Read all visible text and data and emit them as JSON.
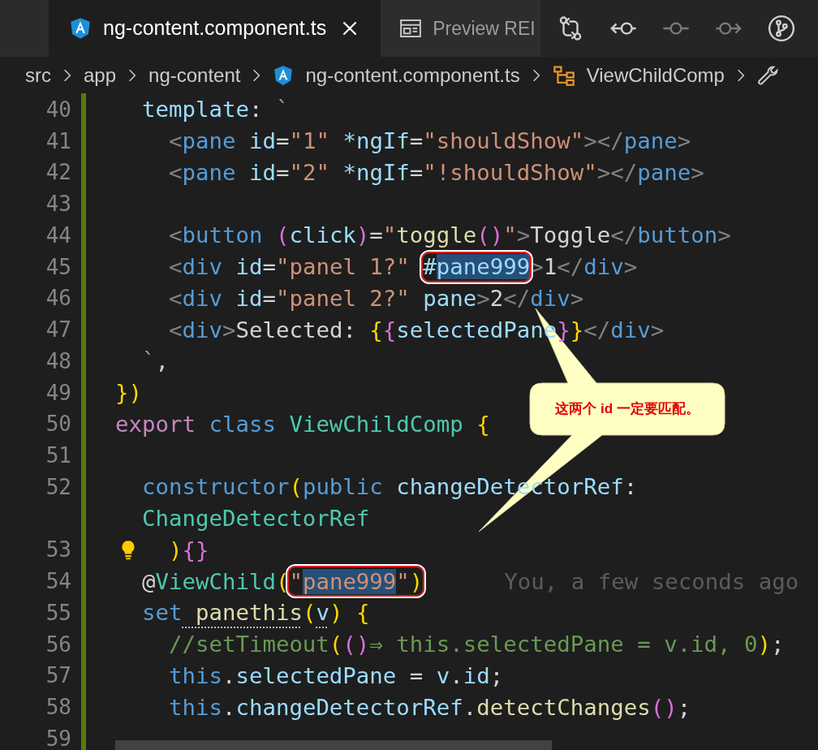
{
  "tabs": [
    {
      "kind": "angular",
      "label": "ng-content.component.ts",
      "selected": true
    },
    {
      "kind": "preview",
      "label": "Preview REI",
      "selected": false
    }
  ],
  "toolbar_buttons": [
    {
      "kind": "compare",
      "disabled": false
    },
    {
      "kind": "back",
      "disabled": false
    },
    {
      "kind": "dot",
      "disabled": true
    },
    {
      "kind": "forward",
      "disabled": true
    },
    {
      "kind": "branch",
      "disabled": false
    }
  ],
  "breadcrumb": [
    {
      "kind": "folder",
      "label": "src"
    },
    {
      "kind": "folder",
      "label": "app"
    },
    {
      "kind": "folder",
      "label": "ng-content"
    },
    {
      "kind": "angular",
      "label": "ng-content.component.ts"
    },
    {
      "kind": "class",
      "label": "ViewChildComp"
    },
    {
      "kind": "method"
    }
  ],
  "editor": {
    "lines": [
      {
        "number": "40",
        "tokens": [
          {
            "kind": "var",
            "text": "  template"
          },
          {
            "kind": "plain",
            "text": ":"
          },
          {
            "kind": "string",
            "text": " `"
          }
        ]
      },
      {
        "number": "41",
        "tokens": [
          {
            "kind": "tag",
            "text": "    <"
          },
          {
            "kind": "tagname",
            "text": "pane"
          },
          {
            "kind": "var",
            "text": " id"
          },
          {
            "kind": "plain",
            "text": "="
          },
          {
            "kind": "string",
            "text": "\"1\""
          },
          {
            "kind": "var",
            "text": " *ngIf"
          },
          {
            "kind": "plain",
            "text": "="
          },
          {
            "kind": "string",
            "text": "\"shouldShow\""
          },
          {
            "kind": "tag",
            "text": "></"
          },
          {
            "kind": "tagname",
            "text": "pane"
          },
          {
            "kind": "tag",
            "text": ">"
          }
        ]
      },
      {
        "number": "42",
        "tokens": [
          {
            "kind": "tag",
            "text": "    <"
          },
          {
            "kind": "tagname",
            "text": "pane"
          },
          {
            "kind": "var",
            "text": " id"
          },
          {
            "kind": "plain",
            "text": "="
          },
          {
            "kind": "string",
            "text": "\"2\""
          },
          {
            "kind": "var",
            "text": " *ngIf"
          },
          {
            "kind": "plain",
            "text": "="
          },
          {
            "kind": "string",
            "text": "\"!shouldShow\""
          },
          {
            "kind": "tag",
            "text": "></"
          },
          {
            "kind": "tagname",
            "text": "pane"
          },
          {
            "kind": "tag",
            "text": ">"
          }
        ]
      },
      {
        "number": "43"
      },
      {
        "number": "44",
        "tokens": [
          {
            "kind": "tag",
            "text": "    <"
          },
          {
            "kind": "tagname",
            "text": "button"
          },
          {
            "kind": "b2",
            "text": " ("
          },
          {
            "kind": "var",
            "text": "click"
          },
          {
            "kind": "b2",
            "text": ")"
          },
          {
            "kind": "plain",
            "text": "="
          },
          {
            "kind": "string",
            "text": "\""
          },
          {
            "kind": "func",
            "text": "toggle"
          },
          {
            "kind": "b2",
            "text": "()"
          },
          {
            "kind": "string",
            "text": "\""
          },
          {
            "kind": "tag",
            "text": ">"
          },
          {
            "kind": "plain",
            "text": "Toggle"
          },
          {
            "kind": "tag",
            "text": "</"
          },
          {
            "kind": "tagname",
            "text": "button"
          },
          {
            "kind": "tag",
            "text": ">"
          }
        ]
      },
      {
        "number": "45",
        "tokens": [
          {
            "kind": "tag",
            "text": "    <"
          },
          {
            "kind": "tagname",
            "text": "div"
          },
          {
            "kind": "var",
            "text": " id"
          },
          {
            "kind": "plain",
            "text": "="
          },
          {
            "kind": "string",
            "text": "\"panel 1?\" "
          },
          {
            "kind": "var",
            "text": "#",
            "ringed": true
          },
          {
            "kind": "var",
            "text": "pane999",
            "ringed": true,
            "highlighted": true
          },
          {
            "kind": "tag",
            "text": ">"
          },
          {
            "kind": "plain",
            "text": "1"
          },
          {
            "kind": "tag",
            "text": "</"
          },
          {
            "kind": "tagname",
            "text": "div"
          },
          {
            "kind": "tag",
            "text": ">"
          }
        ]
      },
      {
        "number": "46",
        "tokens": [
          {
            "kind": "tag",
            "text": "    <"
          },
          {
            "kind": "tagname",
            "text": "div"
          },
          {
            "kind": "var",
            "text": " id"
          },
          {
            "kind": "plain",
            "text": "="
          },
          {
            "kind": "string",
            "text": "\"panel 2?\""
          },
          {
            "kind": "var",
            "text": " pane"
          },
          {
            "kind": "tag",
            "text": ">"
          },
          {
            "kind": "plain",
            "text": "2"
          },
          {
            "kind": "tag",
            "text": "</"
          },
          {
            "kind": "tagname",
            "text": "div"
          },
          {
            "kind": "tag",
            "text": ">"
          }
        ]
      },
      {
        "number": "47",
        "tokens": [
          {
            "kind": "tag",
            "text": "    <"
          },
          {
            "kind": "tagname",
            "text": "div"
          },
          {
            "kind": "tag",
            "text": ">"
          },
          {
            "kind": "plain",
            "text": "Selected: "
          },
          {
            "kind": "b1",
            "text": "{"
          },
          {
            "kind": "b2",
            "text": "{"
          },
          {
            "kind": "var",
            "text": "selectedPane"
          },
          {
            "kind": "b2",
            "text": "}"
          },
          {
            "kind": "b1",
            "text": "}"
          },
          {
            "kind": "tag",
            "text": "</"
          },
          {
            "kind": "tagname",
            "text": "div"
          },
          {
            "kind": "tag",
            "text": ">"
          }
        ]
      },
      {
        "number": "48",
        "tokens": [
          {
            "kind": "string",
            "text": "  `"
          },
          {
            "kind": "plain",
            "text": ","
          }
        ]
      },
      {
        "number": "49",
        "tokens": [
          {
            "kind": "b1",
            "text": "})"
          }
        ]
      },
      {
        "number": "50",
        "tokens": [
          {
            "kind": "keyword",
            "text": "export"
          },
          {
            "kind": "storage",
            "text": " class"
          },
          {
            "kind": "type",
            "text": " ViewChildComp"
          },
          {
            "kind": "b1",
            "text": " {"
          }
        ]
      },
      {
        "number": "51"
      },
      {
        "number": "52",
        "tokens": [
          {
            "kind": "storage",
            "text": "  constructor"
          },
          {
            "kind": "b1",
            "text": "("
          },
          {
            "kind": "storage",
            "text": "public"
          },
          {
            "kind": "var",
            "text": " changeDetectorRef"
          },
          {
            "kind": "plain",
            "text": ":"
          }
        ]
      },
      {
        "tokens": [
          {
            "kind": "type",
            "text": "  ChangeDetectorRef"
          }
        ]
      },
      {
        "number": "53",
        "lightbulb": true,
        "tokens": [
          {
            "kind": "b1",
            "text": "    )"
          },
          {
            "kind": "b2",
            "text": "{}"
          }
        ]
      },
      {
        "number": "54",
        "blame": "You, a few seconds ago",
        "tokens": [
          {
            "kind": "plain",
            "text": "  @"
          },
          {
            "kind": "type",
            "text": "ViewChild"
          },
          {
            "kind": "b1",
            "text": "("
          },
          {
            "kind": "string",
            "text": "\"",
            "ringed": true
          },
          {
            "kind": "string",
            "text": "pane999",
            "ringed": true,
            "highlighted": true
          },
          {
            "kind": "string",
            "text": "\"",
            "ringed": true
          },
          {
            "kind": "b1",
            "text": ")",
            "ringed": true
          }
        ]
      },
      {
        "number": "55",
        "tokens": [
          {
            "kind": "storage",
            "text": "  set"
          },
          {
            "kind": "func",
            "text": " panethis",
            "hint": true
          },
          {
            "kind": "b1",
            "text": "("
          },
          {
            "kind": "var",
            "text": "v",
            "hint": true
          },
          {
            "kind": "b1",
            "text": ")"
          },
          {
            "kind": "b1",
            "text": " {"
          }
        ]
      },
      {
        "number": "56",
        "tokens": [
          {
            "kind": "comment",
            "text": "    //setTimeout"
          },
          {
            "kind": "b1",
            "text": "("
          },
          {
            "kind": "b2",
            "text": "()"
          },
          {
            "kind": "comment",
            "text": "⇒ this.selectedPane = v.id, 0"
          },
          {
            "kind": "b1",
            "text": ")"
          },
          {
            "kind": "plain",
            "text": ";"
          }
        ]
      },
      {
        "number": "57",
        "tokens": [
          {
            "kind": "storage",
            "text": "    this"
          },
          {
            "kind": "plain",
            "text": "."
          },
          {
            "kind": "var",
            "text": "selectedPane"
          },
          {
            "kind": "plain",
            "text": " = "
          },
          {
            "kind": "var",
            "text": "v"
          },
          {
            "kind": "plain",
            "text": "."
          },
          {
            "kind": "var",
            "text": "id"
          },
          {
            "kind": "plain",
            "text": ";"
          }
        ]
      },
      {
        "number": "58",
        "tokens": [
          {
            "kind": "storage",
            "text": "    this"
          },
          {
            "kind": "plain",
            "text": "."
          },
          {
            "kind": "var",
            "text": "changeDetectorRef"
          },
          {
            "kind": "plain",
            "text": "."
          },
          {
            "kind": "func",
            "text": "detectChanges"
          },
          {
            "kind": "b2",
            "text": "()"
          },
          {
            "kind": "plain",
            "text": ";"
          }
        ]
      },
      {
        "number": "59"
      }
    ]
  },
  "callout": {
    "text": "这两个 id 一定要匹配。"
  }
}
